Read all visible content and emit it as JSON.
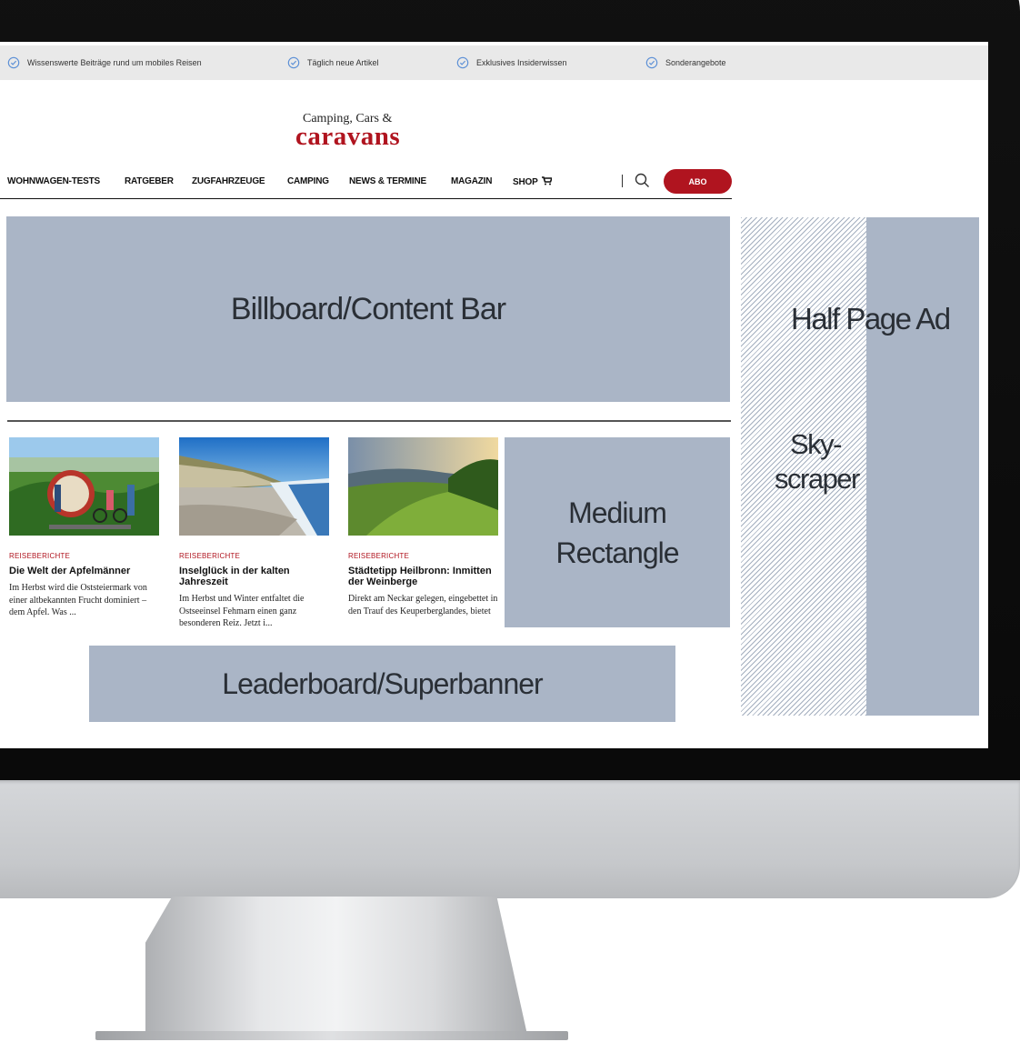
{
  "topbar": {
    "usps": [
      {
        "label": "Wissenswerte Beiträge rund um mobiles Reisen"
      },
      {
        "label": "Täglich neue Artikel"
      },
      {
        "label": "Exklusives Insiderwissen"
      },
      {
        "label": "Sonderangebote"
      }
    ]
  },
  "logo": {
    "line1": "Camping, Cars &",
    "line2": "caravans"
  },
  "nav": {
    "items": [
      "WOHNWAGEN-TESTS",
      "RATGEBER",
      "ZUGFAHRZEUGE",
      "CAMPING",
      "NEWS & TERMINE",
      "MAGAZIN",
      "SHOP"
    ],
    "abo_label": "ABO"
  },
  "ads": {
    "billboard": "Billboard/Content Bar",
    "half_page": "Half Page Ad",
    "skyscraper_line1": "Sky-",
    "skyscraper_line2": "scraper",
    "medium_line1": "Medium",
    "medium_line2": "Rectangle",
    "leaderboard": "Leaderboard/Superbanner"
  },
  "articles": [
    {
      "category": "REISEBERICHTE",
      "title": "Die Welt der Apfelmänner",
      "teaser": "Im Herbst wird die Oststeiermark von einer altbekannten Frucht dominiert – dem Apfel. Was ..."
    },
    {
      "category": "REISEBERICHTE",
      "title": "Inselglück in der kalten Jahreszeit",
      "teaser": "Im Herbst und Winter entfaltet die Ostseeinsel Fehmarn einen ganz besonderen Reiz. Jetzt i..."
    },
    {
      "category": "REISEBERICHTE",
      "title": "Städtetipp Heilbronn: Inmitten der Weinberge",
      "teaser": "Direkt am Neckar gelegen, eingebettet in den Trauf des Keuperberglandes, bietet"
    }
  ],
  "colors": {
    "brand": "#b0141f",
    "ad_placeholder": "#aab5c6",
    "topbar": "#e9e9e9"
  }
}
